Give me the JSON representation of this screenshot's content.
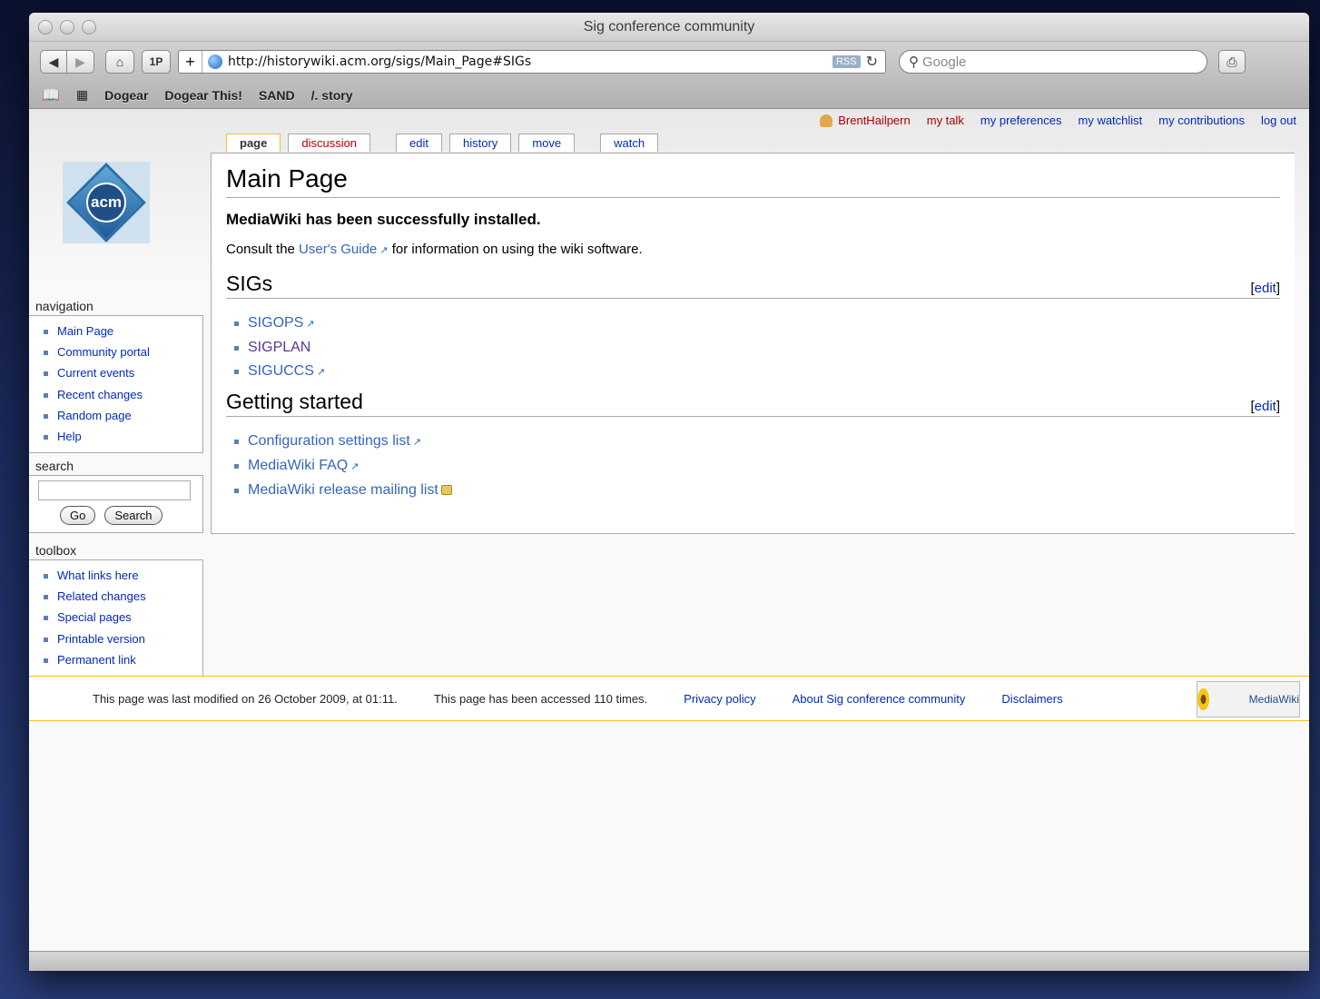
{
  "window": {
    "title": "Sig conference community"
  },
  "toolbar": {
    "back": "◀",
    "forward": "▶",
    "home": "⌂",
    "onepassword": "1P",
    "add": "+",
    "url": "http://historywiki.acm.org/sigs/Main_Page#SIGs",
    "rss": "RSS",
    "reload": "↻",
    "search_placeholder": "Google",
    "print": "⎙"
  },
  "bookmarks": {
    "items": [
      "Dogear",
      "Dogear This!",
      "SAND",
      "/. story"
    ]
  },
  "personal": {
    "user": "BrentHailpern",
    "talk": "my talk",
    "preferences": "my preferences",
    "watchlist": "my watchlist",
    "contributions": "my contributions",
    "logout": "log out"
  },
  "tabs": [
    "page",
    "discussion",
    "edit",
    "history",
    "move",
    "watch"
  ],
  "logo": {
    "text": "acm"
  },
  "navigation": {
    "title": "navigation",
    "items": [
      "Main Page",
      "Community portal",
      "Current events",
      "Recent changes",
      "Random page",
      "Help"
    ]
  },
  "search": {
    "title": "search",
    "go": "Go",
    "search": "Search"
  },
  "toolbox": {
    "title": "toolbox",
    "items": [
      "What links here",
      "Related changes",
      "Special pages",
      "Printable version",
      "Permanent link"
    ]
  },
  "content": {
    "title": "Main Page",
    "installed": "MediaWiki has been successfully installed.",
    "consult_pre": "Consult the ",
    "consult_link": "User's Guide",
    "consult_post": " for information on using the wiki software.",
    "edit": "edit",
    "sigs_heading": "SIGs",
    "sigs": [
      "SIGOPS",
      "SIGPLAN",
      "SIGUCCS"
    ],
    "gs_heading": "Getting started",
    "gs_items": [
      "Configuration settings list",
      "MediaWiki FAQ",
      "MediaWiki release mailing list"
    ]
  },
  "footer": {
    "modified": "This page was last modified on 26 October 2009, at 01:11.",
    "accessed": "This page has been accessed 110 times.",
    "privacy": "Privacy policy",
    "about": "About Sig conference community",
    "disclaimers": "Disclaimers",
    "powered": "MediaWiki"
  }
}
